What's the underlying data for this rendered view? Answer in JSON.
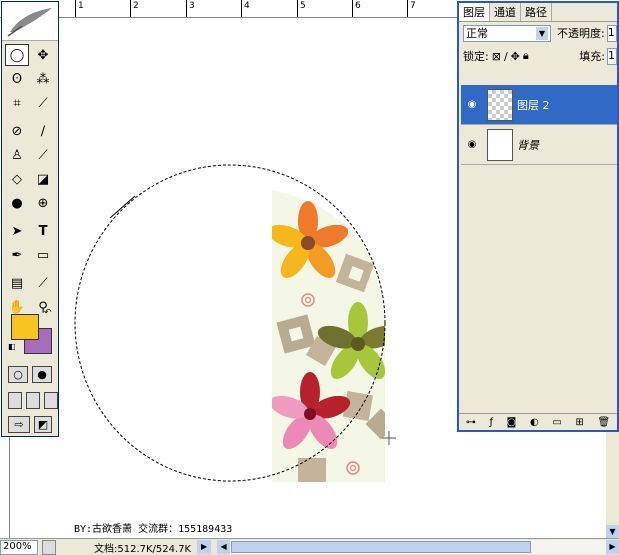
{
  "ruler": {
    "top_labels": [
      "1",
      "2",
      "3",
      "4",
      "5",
      "6",
      "7"
    ]
  },
  "credit_text": "BY:古欲香萧 交流群：155189433",
  "toolbox": {
    "tools": [
      [
        "marquee-ellipse-icon",
        "move-icon"
      ],
      [
        "lasso-icon",
        "magic-wand-icon"
      ],
      [
        "crop-icon",
        "slice-icon"
      ],
      [
        "healing-brush-icon",
        "brush-icon"
      ],
      [
        "clone-stamp-icon",
        "history-brush-icon"
      ],
      [
        "eraser-icon",
        "paint-bucket-icon"
      ],
      [
        "blur-icon",
        "dodge-icon"
      ],
      [
        "path-select-icon",
        "type-icon"
      ],
      [
        "pen-icon",
        "rectangle-icon"
      ],
      [
        "notes-icon",
        "eyedropper-icon"
      ],
      [
        "hand-icon",
        "zoom-icon"
      ]
    ],
    "colors": {
      "foreground": "#f7c520",
      "background": "#a86cbc"
    }
  },
  "layers_panel": {
    "tabs": [
      "图层",
      "通道",
      "路径"
    ],
    "blend_mode": "正常",
    "opacity_label": "不透明度:",
    "opacity_value": "1",
    "lock_label": "锁定:",
    "fill_label": "填充:",
    "fill_value": "1",
    "layers": [
      {
        "name": "图层 2",
        "selected": true,
        "thumb": "transparent"
      },
      {
        "name": "背景",
        "selected": false,
        "thumb": "white"
      }
    ]
  },
  "status": {
    "zoom": "200%",
    "doc_info": "文档:512.7K/524.7K"
  }
}
